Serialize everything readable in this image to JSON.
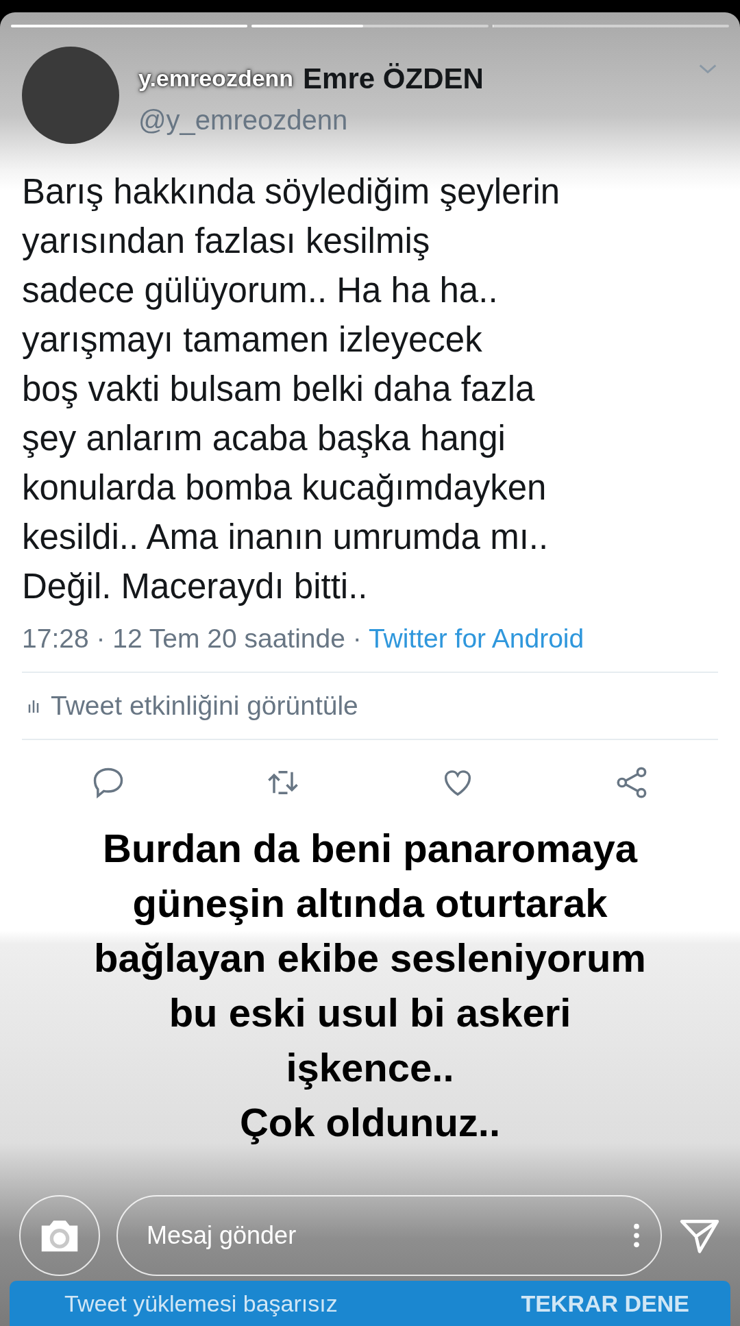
{
  "story": {
    "progress": [
      {
        "level": 1
      },
      {
        "level": 0.47
      },
      {
        "level": 0
      }
    ],
    "username": "y.emreozdenn"
  },
  "tweet": {
    "display_name": "Emre ÖZDEN",
    "handle": "@y_emreozdenn",
    "text": "Barış hakkında söylediğim şeylerin\nyarısından fazlası kesilmiş\nsadece gülüyorum.. Ha ha ha..\nyarışmayı tamamen izleyecek\nboş vakti bulsam belki daha fazla\nşey anlarım acaba başka hangi\nkonularda bomba kucağımdayken\nkesildi.. Ama inanın umrumda mı..\nDeğil. Maceraydı bitti..",
    "time": "17:28 · 12 Tem 20 saatinde · ",
    "source": "Twitter for Android",
    "activity": "Tweet etkinliğini görüntüle"
  },
  "caption": "Burdan da beni panaromaya\ngüneşin altında oturtarak\nbağlayan ekibe sesleniyorum\nbu eski usul bi askeri\nişkence..\nÇok oldunuz..",
  "reply": {
    "placeholder": "Mesaj gönder"
  },
  "banner": {
    "message": "Tweet yüklemesi başarısız",
    "action": "TEKRAR DENE"
  }
}
